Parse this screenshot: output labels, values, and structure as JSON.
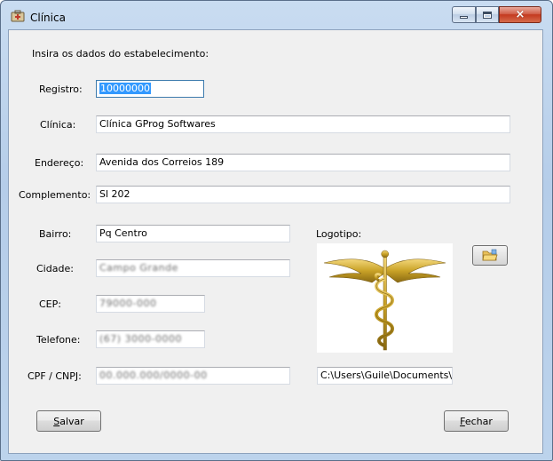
{
  "window": {
    "title": "Clínica",
    "controls": {
      "minimize": "minimize",
      "maximize": "maximize",
      "close": "×"
    }
  },
  "form": {
    "intro": "Insira os dados do estabelecimento:",
    "fields": {
      "registro": {
        "label": "Registro:",
        "value": "10000000"
      },
      "clinica": {
        "label": "Clínica:",
        "value": "Clínica GProg Softwares"
      },
      "endereco": {
        "label": "Endereço:",
        "value": "Avenida dos Correios 189"
      },
      "complemento": {
        "label": "Complemento:",
        "value": "Sl 202"
      },
      "bairro": {
        "label": "Bairro:",
        "value": "Pq Centro"
      },
      "cidade": {
        "label": "Cidade:",
        "value": "Campo Grande"
      },
      "cep": {
        "label": "CEP:",
        "value": "79000-000"
      },
      "telefone": {
        "label": "Telefone:",
        "value": "(67) 3000-0000"
      },
      "cpf_cnpj": {
        "label": "CPF / CNPJ:",
        "value": "00.000.000/0000-00"
      }
    },
    "logo": {
      "label": "Logotipo:",
      "path": "C:\\Users\\Guile\\Documents\\Proj",
      "image_icon": "caduceus-icon",
      "browse_icon": "folder-icon"
    },
    "buttons": {
      "save_prefix": "S",
      "save_rest": "alvar",
      "close_prefix": "F",
      "close_rest": "echar"
    }
  },
  "colors": {
    "selection": "#3399ff",
    "logo_gold": "#c9a227"
  }
}
